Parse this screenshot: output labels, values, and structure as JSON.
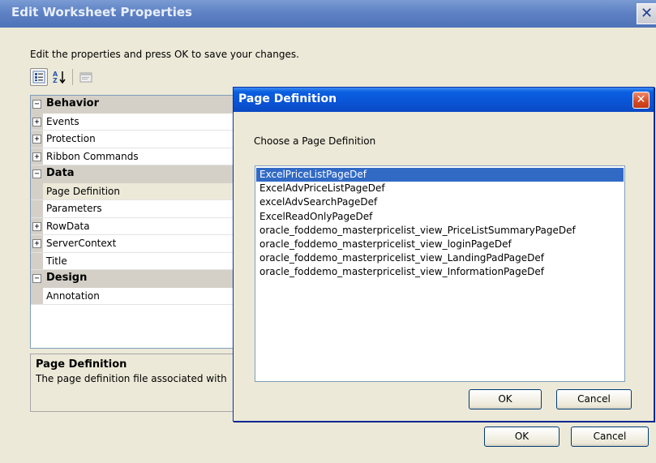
{
  "window": {
    "title": "Edit Worksheet Properties",
    "close_glyph": "✕",
    "instructions": "Edit the properties and press OK to save your changes.",
    "ok_label": "OK",
    "cancel_label": "Cancel"
  },
  "toolbar": {
    "items": [
      {
        "name": "categorized-icon",
        "pressed": true
      },
      {
        "name": "alphabetical-sort-icon",
        "pressed": false
      },
      {
        "name": "property-pages-icon",
        "pressed": false
      }
    ],
    "sort_glyph": "A↓"
  },
  "property_grid": {
    "rows": [
      {
        "label": "Behavior",
        "kind": "category",
        "toggle": "⊟"
      },
      {
        "label": "Events",
        "kind": "expandable",
        "toggle": "+"
      },
      {
        "label": "Protection",
        "kind": "expandable",
        "toggle": "+"
      },
      {
        "label": "Ribbon Commands",
        "kind": "expandable",
        "toggle": "+"
      },
      {
        "label": "Data",
        "kind": "category",
        "toggle": "⊟"
      },
      {
        "label": "Page Definition",
        "kind": "property"
      },
      {
        "label": "Parameters",
        "kind": "property"
      },
      {
        "label": "RowData",
        "kind": "expandable",
        "toggle": "+"
      },
      {
        "label": "ServerContext",
        "kind": "expandable",
        "toggle": "+"
      },
      {
        "label": "Title",
        "kind": "property"
      },
      {
        "label": "Design",
        "kind": "category",
        "toggle": "⊟"
      },
      {
        "label": "Annotation",
        "kind": "property"
      }
    ],
    "selected_index": 5
  },
  "help": {
    "title": "Page Definition",
    "text": "The page definition file associated with"
  },
  "dialog": {
    "title": "Page Definition",
    "close_glyph": "✕",
    "prompt": "Choose a Page Definition",
    "items": [
      "ExcelPriceListPageDef",
      "ExcelAdvPriceListPageDef",
      "excelAdvSearchPageDef",
      "ExcelReadOnlyPageDef",
      "oracle_foddemo_masterpricelist_view_PriceListSummaryPageDef",
      "oracle_foddemo_masterpricelist_view_loginPageDef",
      "oracle_foddemo_masterpricelist_view_LandingPadPageDef",
      "oracle_foddemo_masterpricelist_view_InformationPageDef"
    ],
    "selected_index": 0,
    "ok_label": "OK",
    "cancel_label": "Cancel"
  },
  "colors": {
    "selection": "#316ac5",
    "dialog_title": "#0a54d6",
    "outer_title": "#5e82c4",
    "window_bg": "#ece9d8"
  }
}
